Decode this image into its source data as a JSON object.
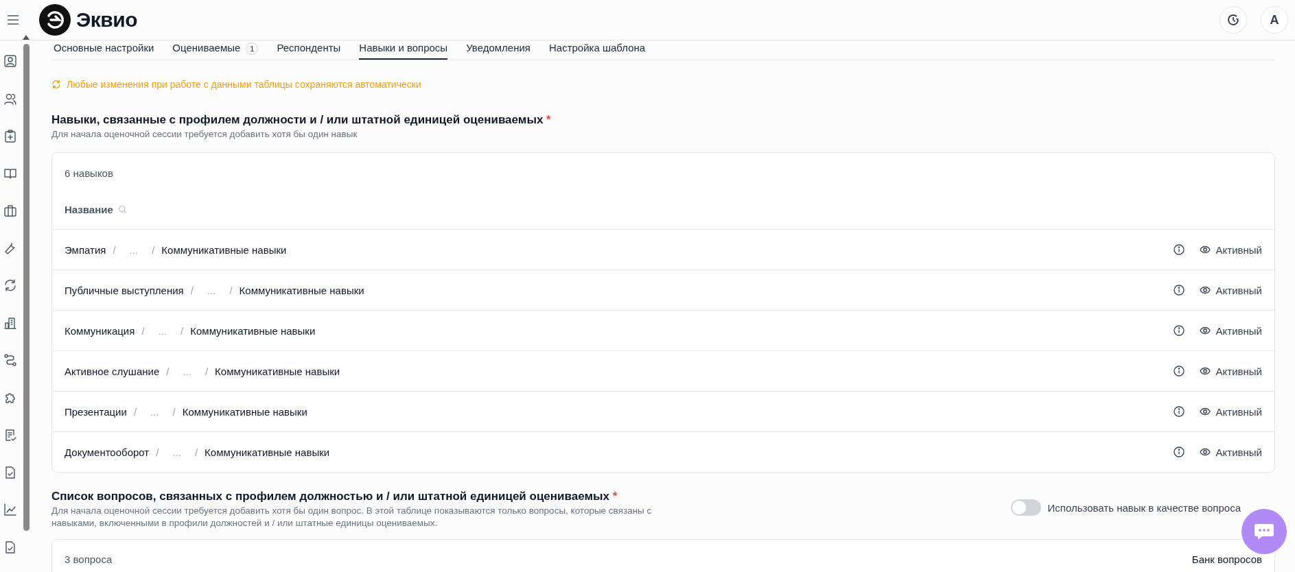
{
  "header": {
    "logo_text": "Эквио",
    "avatar": "А"
  },
  "tabs": [
    {
      "label": "Основные настройки",
      "selected": false
    },
    {
      "label": "Оцениваемые",
      "badge": "1",
      "selected": false
    },
    {
      "label": "Респонденты",
      "selected": false
    },
    {
      "label": "Навыки и вопросы",
      "selected": true
    },
    {
      "label": "Уведомления",
      "selected": false
    },
    {
      "label": "Настройка шаблона",
      "selected": false
    }
  ],
  "autosave_notice": "Любые изменения при работе с данными таблицы сохраняются автоматически",
  "skills_section": {
    "title": "Навыки, связанные с профилем должности и / или штатной единицей оцениваемых",
    "required_mark": "*",
    "hint": "Для начала оценочной сессии требуется добавить хотя бы один навык",
    "count": "6 навыков",
    "column": "Название",
    "rows": [
      {
        "name": "Эмпатия",
        "sep1": "/",
        "middle": "...",
        "sep2": "/",
        "group": "Коммуникативные навыки",
        "status": "Активный"
      },
      {
        "name": "Публичные выступления",
        "sep1": "/",
        "middle": "...",
        "sep2": "/",
        "group": "Коммуникативные навыки",
        "status": "Активный"
      },
      {
        "name": "Коммуникация",
        "sep1": "/",
        "middle": "...",
        "sep2": "/",
        "group": "Коммуникативные навыки",
        "status": "Активный"
      },
      {
        "name": "Активное слушание",
        "sep1": "/",
        "middle": "...",
        "sep2": "/",
        "group": "Коммуникативные навыки",
        "status": "Активный"
      },
      {
        "name": "Презентации",
        "sep1": "/",
        "middle": "...",
        "sep2": "/",
        "group": "Коммуникативные навыки",
        "status": "Активный"
      },
      {
        "name": "Документооборот",
        "sep1": "/",
        "middle": "...",
        "sep2": "/",
        "group": "Коммуникативные навыки",
        "status": "Активный"
      }
    ]
  },
  "questions_section": {
    "title": "Список вопросов, связанных с профилем должностью и / или штатной единицей оцениваемых",
    "required_mark": "*",
    "hint": "Для начала оценочной сессии требуется добавить хотя бы один вопрос. В этой таблице показываются только вопросы, которые связаны с навыками, включенными в профили должностей и / или штатные единицы оцениваемых.",
    "toggle": {
      "label": "Использовать навык в качестве вопроса",
      "on": false
    },
    "count": "3 вопроса",
    "bank_link": "Банк вопросов"
  }
}
